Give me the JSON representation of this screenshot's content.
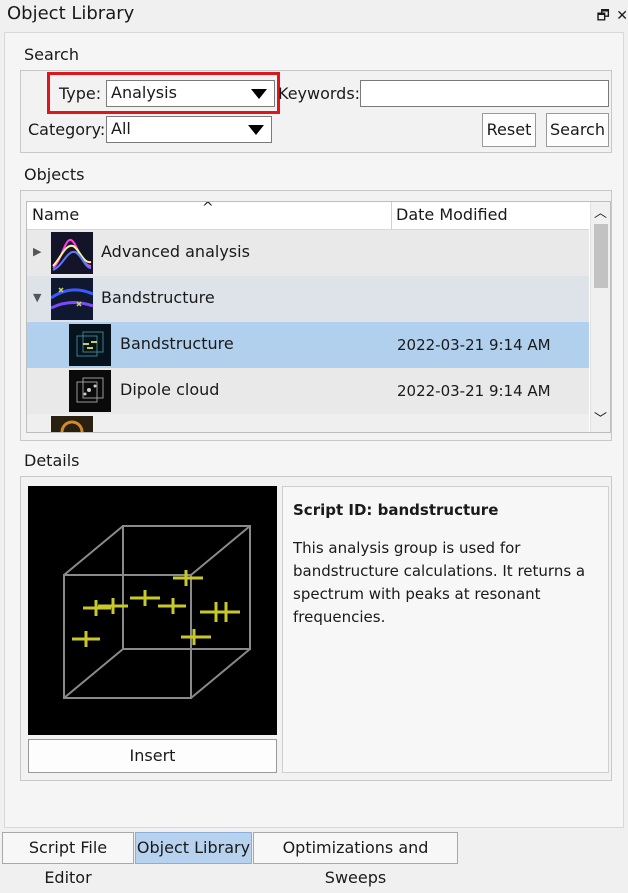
{
  "window": {
    "title": "Object Library",
    "restore_glyph": "🗗",
    "close_glyph": "✕"
  },
  "search": {
    "section_label": "Search",
    "type_label": "Type:",
    "type_value": "Analysis",
    "keywords_label": "Keywords:",
    "keywords_value": "",
    "category_label": "Category:",
    "category_value": "All",
    "reset_label": "Reset",
    "search_label": "Search"
  },
  "objects": {
    "section_label": "Objects",
    "columns": [
      "Name",
      "Date Modified"
    ],
    "sort_indicator": "^",
    "rows": [
      {
        "name": "Advanced analysis",
        "date": "",
        "expander": "▶",
        "level": 0
      },
      {
        "name": "Bandstructure",
        "date": "",
        "expander": "▼",
        "level": 0
      },
      {
        "name": "Bandstructure",
        "date": "2022-03-21 9:14 AM",
        "expander": "",
        "level": 1
      },
      {
        "name": "Dipole cloud",
        "date": "2022-03-21 9:14 AM",
        "expander": "",
        "level": 1
      }
    ],
    "scroll_up": "︿",
    "scroll_down": "﹀"
  },
  "details": {
    "section_label": "Details",
    "script_id": "Script ID: bandstructure",
    "description": "This analysis group is used for bandstructure calculations. It returns a spectrum with peaks at resonant frequencies.",
    "insert_label": "Insert"
  },
  "tabs": [
    {
      "label": "Script File Editor",
      "active": false
    },
    {
      "label": "Object Library",
      "active": true
    },
    {
      "label": "Optimizations and Sweeps",
      "active": false
    }
  ],
  "colors": {
    "selected_row": "#b0d0ee",
    "hover_row": "#dde3e9",
    "highlight_border": "#e0141b",
    "active_tab": "#b7d2ee"
  }
}
